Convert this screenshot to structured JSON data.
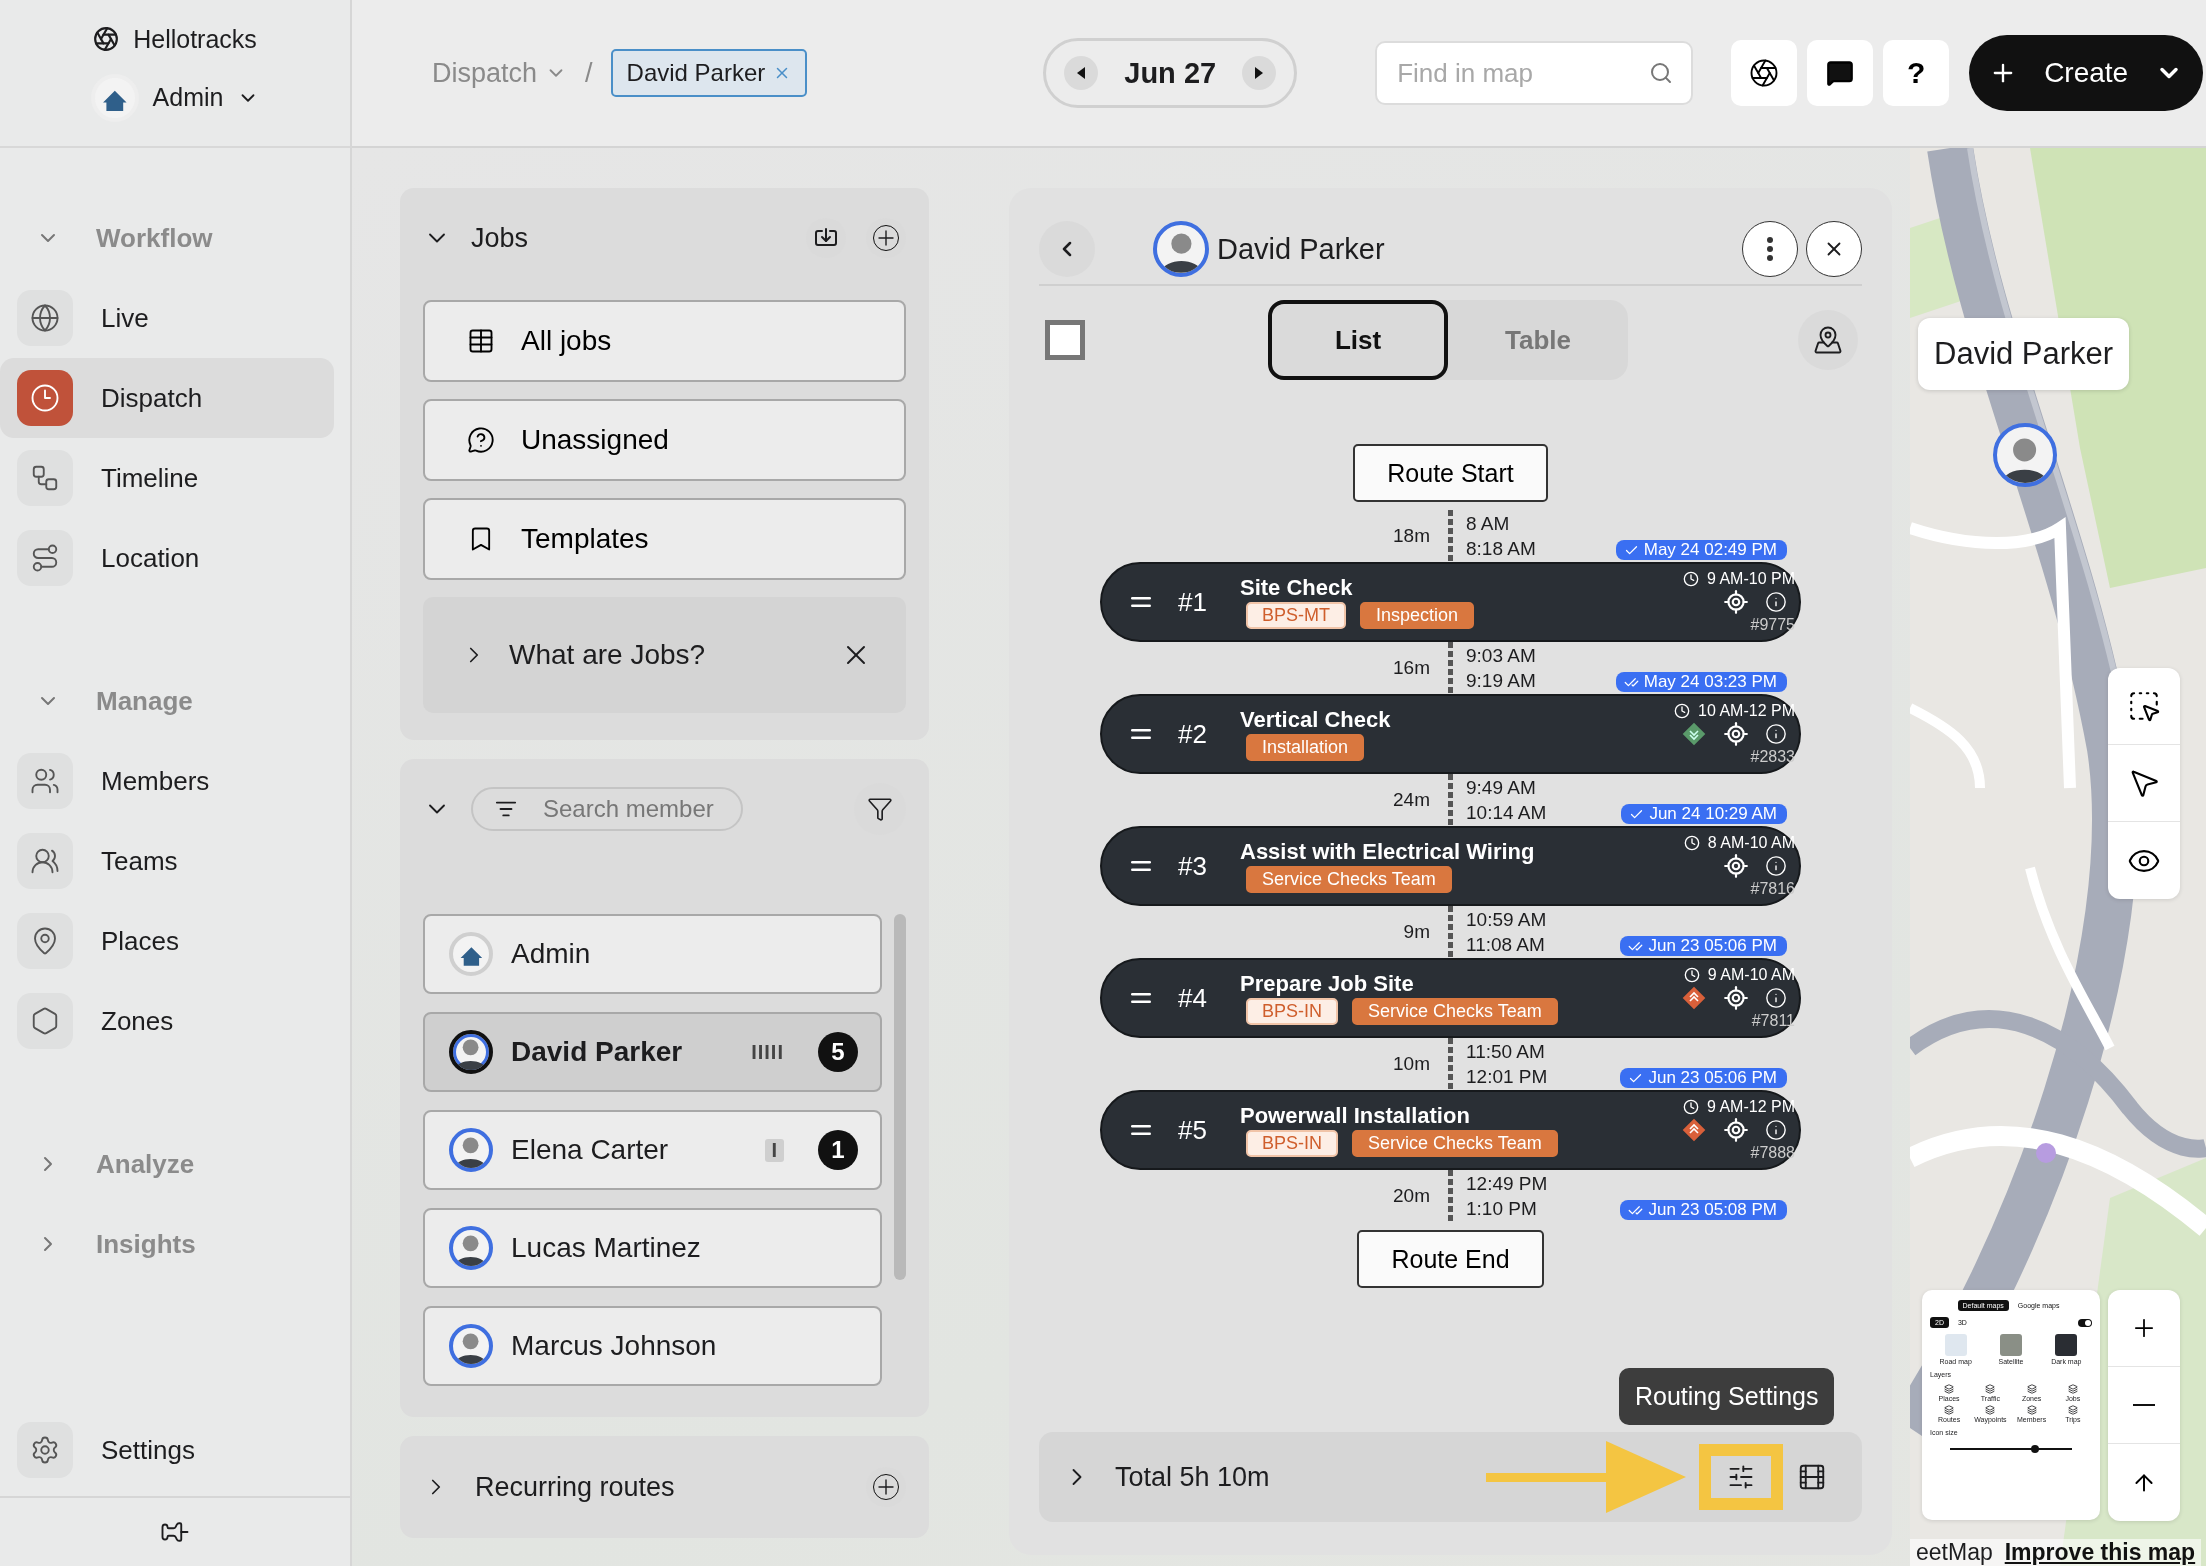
{
  "brand": {
    "name": "Hellotracks",
    "account": "Admin"
  },
  "sidebar": {
    "sections": [
      {
        "title": "Workflow",
        "expanded": true,
        "items": [
          {
            "label": "Live",
            "selected": false
          },
          {
            "label": "Dispatch",
            "selected": true
          },
          {
            "label": "Timeline",
            "selected": false
          },
          {
            "label": "Location",
            "selected": false
          }
        ]
      },
      {
        "title": "Manage",
        "expanded": true,
        "items": [
          {
            "label": "Members",
            "selected": false
          },
          {
            "label": "Teams",
            "selected": false
          },
          {
            "label": "Places",
            "selected": false
          },
          {
            "label": "Zones",
            "selected": false
          }
        ]
      },
      {
        "title": "Analyze",
        "expanded": false
      },
      {
        "title": "Insights",
        "expanded": false
      }
    ],
    "settings": "Settings"
  },
  "topbar": {
    "breadcrumb": "Dispatch",
    "separator": "/",
    "chip": "David Parker",
    "date": "Jun 27",
    "search": {
      "placeholder": "Find in map"
    },
    "help": "?",
    "create": "Create"
  },
  "jobs_panel": {
    "title": "Jobs",
    "links": [
      "All jobs",
      "Unassigned",
      "Templates"
    ],
    "help": "What are Jobs?"
  },
  "members_panel": {
    "search": {
      "placeholder": "Search member"
    },
    "members": [
      {
        "name": "Admin",
        "kind": "logo",
        "selected": false
      },
      {
        "name": "David Parker",
        "kind": "person",
        "selected": true,
        "bars": "IIIII",
        "count": "5"
      },
      {
        "name": "Elena Carter",
        "kind": "person",
        "selected": false,
        "bars": "I",
        "count": "1"
      },
      {
        "name": "Lucas Martinez",
        "kind": "person",
        "selected": false
      },
      {
        "name": "Marcus Johnson",
        "kind": "person",
        "selected": false
      }
    ]
  },
  "recurring": {
    "title": "Recurring routes"
  },
  "route_panel": {
    "member": "David Parker",
    "tabs": [
      {
        "label": "List",
        "selected": true
      },
      {
        "label": "Table",
        "selected": false
      }
    ],
    "select_all": {
      "checked": false
    },
    "start": "Route Start",
    "end": "Route End",
    "route": [
      {
        "kind": "segment",
        "duration": "18m",
        "depart": "8 AM",
        "arrive": "8:18 AM",
        "stamp": "May 24 02:49 PM",
        "double": false
      },
      {
        "kind": "job",
        "number": "#1",
        "title": "Site Check",
        "tags": [
          {
            "label": "BPS-MT",
            "kind": "light"
          },
          {
            "label": "Inspection",
            "kind": "solid"
          }
        ],
        "window": "9 AM-10 PM",
        "id": "#9775"
      },
      {
        "kind": "segment",
        "duration": "16m",
        "depart": "9:03 AM",
        "arrive": "9:19 AM",
        "stamp": "May 24 03:23 PM",
        "double": true
      },
      {
        "kind": "job",
        "number": "#2",
        "title": "Vertical Check",
        "tags": [
          {
            "label": "Installation",
            "kind": "solid"
          }
        ],
        "window": "10 AM-12 PM",
        "priority": {
          "kind": "low"
        },
        "id": "#2833"
      },
      {
        "kind": "segment",
        "duration": "24m",
        "depart": "9:49 AM",
        "arrive": "10:14 AM",
        "stamp": "Jun 24 10:29 AM",
        "double": false
      },
      {
        "kind": "job",
        "number": "#3",
        "title": "Assist with Electrical Wiring",
        "tags": [
          {
            "label": "Service Checks Team",
            "kind": "solid"
          }
        ],
        "window": "8 AM-10 AM",
        "id": "#7816"
      },
      {
        "kind": "segment",
        "duration": "9m",
        "depart": "10:59 AM",
        "arrive": "11:08 AM",
        "stamp": "Jun 23 05:06 PM",
        "double": true
      },
      {
        "kind": "job",
        "number": "#4",
        "title": "Prepare Job Site",
        "tags": [
          {
            "label": "BPS-IN",
            "kind": "light"
          },
          {
            "label": "Service Checks Team",
            "kind": "solid"
          }
        ],
        "window": "9 AM-10 AM",
        "priority": {
          "kind": "high"
        },
        "id": "#7811"
      },
      {
        "kind": "segment",
        "duration": "10m",
        "depart": "11:50 AM",
        "arrive": "12:01 PM",
        "stamp": "Jun 23 05:06 PM",
        "double": false
      },
      {
        "kind": "job",
        "number": "#5",
        "title": "Powerwall Installation",
        "tags": [
          {
            "label": "BPS-IN",
            "kind": "light"
          },
          {
            "label": "Service Checks Team",
            "kind": "solid"
          }
        ],
        "window": "9 AM-12 PM",
        "priority": {
          "kind": "high"
        },
        "id": "#7888"
      },
      {
        "kind": "segment",
        "duration": "20m",
        "depart": "12:49 PM",
        "arrive": "1:10 PM",
        "stamp": "Jun 23 05:08 PM",
        "double": true
      }
    ],
    "total": "Total 5h 10m",
    "tooltip": "Routing Settings"
  },
  "map": {
    "pin_label": "David Parker",
    "layers_card": {
      "sources": [
        {
          "label": "Default maps",
          "selected": true
        },
        {
          "label": "Google maps",
          "selected": false
        }
      ],
      "modes": [
        {
          "label": "2D",
          "selected": true
        },
        {
          "label": "3D",
          "selected": false
        }
      ],
      "toggle": {
        "on": true
      },
      "styles": [
        "Road map",
        "Satellite",
        "Dark map"
      ],
      "layers_title": "Layers",
      "layers": [
        "Places",
        "Traffic",
        "Zones",
        "Jobs",
        "Routes",
        "Waypoints",
        "Members",
        "Trips"
      ],
      "icon_size": {
        "label": "Icon size",
        "level": 0.7
      }
    },
    "attribution": "eetMap",
    "improve": "Improve this map"
  }
}
